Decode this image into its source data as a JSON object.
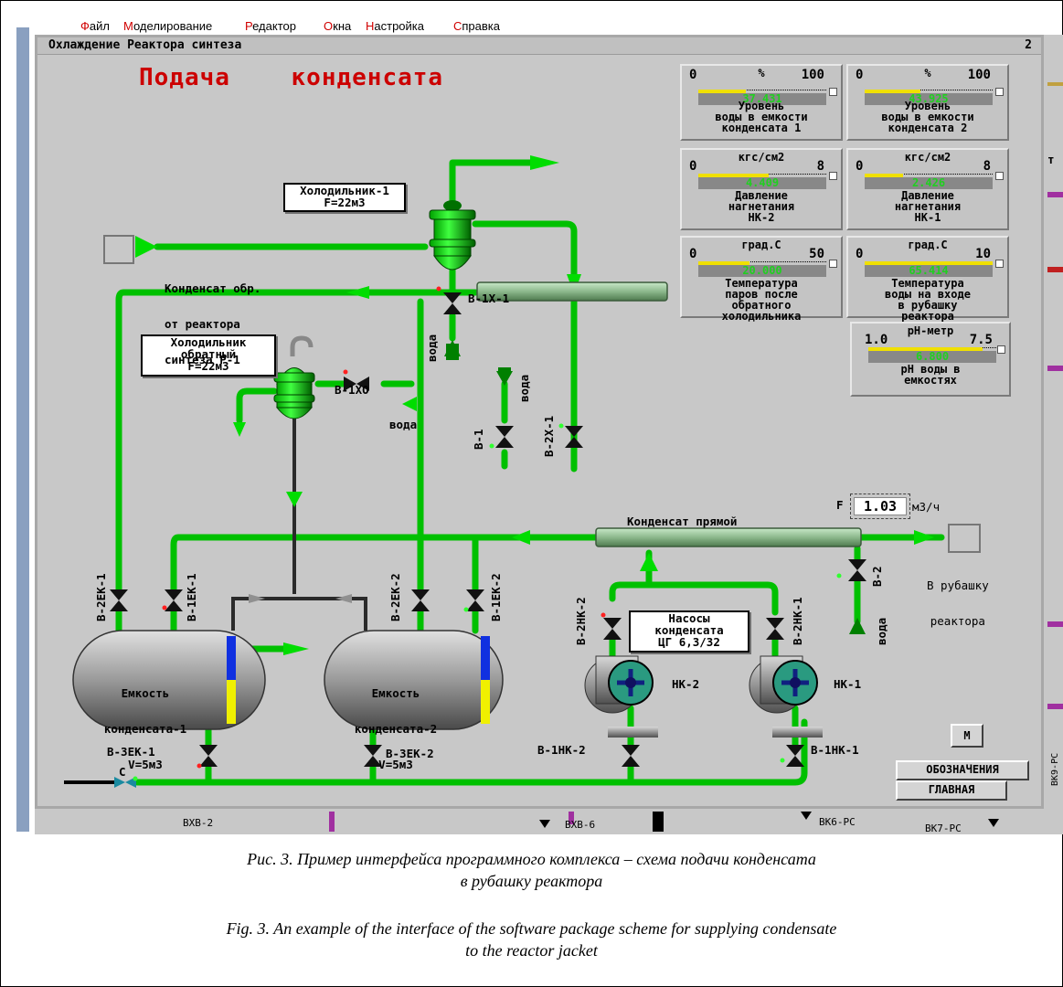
{
  "menu": [
    "Файл",
    "Моделирование",
    "Редактор",
    "Окна",
    "Настройка",
    "Справка"
  ],
  "window": {
    "title": "Охлаждение Реактора синтеза",
    "number": "2"
  },
  "heading": "Подача    конденсата",
  "equipment": {
    "cooler1": [
      "Холодильник-1",
      "F=22м3"
    ],
    "cooler_back": [
      "Холодильник",
      "обратный",
      "F=22м3"
    ],
    "tank1": [
      "Емкость",
      "конденсата-1",
      "V=5м3"
    ],
    "tank2": [
      "Емкость",
      "конденсата-2",
      "V=5м3"
    ],
    "pumps": [
      "Насосы",
      "конденсата",
      "ЦГ 6,3/32"
    ],
    "pump_nk1": "НК-1",
    "pump_nk2": "НК-2"
  },
  "labels": {
    "condensate_return": [
      "Конденсат обр.",
      "от реактора",
      "синтеза Р-1"
    ],
    "condensate_direct": "Конденсат прямой",
    "to_jacket": [
      "В рубашку",
      "реактора"
    ],
    "water": "вода",
    "flow_prefix": "F",
    "flow_value": "1.03",
    "flow_unit": "м3/ч"
  },
  "valves": {
    "v1x1": "В-1Х-1",
    "v1xo": "В-1ХО",
    "v1": "В-1",
    "v2x1": "В-2Х-1",
    "v2ek1": "В-2ЕК-1",
    "v1ek1": "В-1ЕК-1",
    "v2ek2": "В-2ЕК-2",
    "v1ek2": "В-1ЕК-2",
    "v2nk2": "В-2НК-2",
    "v2nk1": "В-2НК-1",
    "v2": "В-2",
    "v3ek1": "В-3ЕК-1",
    "v3ek2": "В-3ЕК-2",
    "v1nk2": "В-1НК-2",
    "v1nk1": "В-1НК-1",
    "c": "С"
  },
  "gauges": [
    {
      "unit": "%",
      "min": "0",
      "max": "100",
      "value": "37.431",
      "level": 0.374,
      "caption": "Уровень\nводы в емкости\nконденсата 1"
    },
    {
      "unit": "%",
      "min": "0",
      "max": "100",
      "value": "43.925",
      "level": 0.439,
      "caption": "Уровень\nводы в емкости\nконденсата 2"
    },
    {
      "unit": "кгс/см2",
      "min": "0",
      "max": "8",
      "value": "4.409",
      "level": 0.551,
      "caption": "Давление\nнагнетания\nНК-2"
    },
    {
      "unit": "кгс/см2",
      "min": "0",
      "max": "8",
      "value": "2.426",
      "level": 0.303,
      "caption": "Давление\nнагнетания\nНК-1"
    },
    {
      "unit": "град.С",
      "min": "0",
      "max": "50",
      "value": "20.000",
      "level": 0.4,
      "caption": "Температура\nпаров после\nобратного\nхолодильника"
    },
    {
      "unit": "град.С",
      "min": "0",
      "max": "10",
      "value": "65.414",
      "level": 1.0,
      "caption": "Температура\nводы на входе\nв рубашку\nреактора"
    },
    {
      "unit": "рН-метр",
      "min": "1.0",
      "max": "7.5",
      "value": "6.800",
      "level": 0.89,
      "caption": "рН воды в\nемкостях"
    }
  ],
  "buttons": {
    "m": "М",
    "legend": "ОБОЗНАЧЕНИЯ",
    "main": "ГЛАВНАЯ"
  },
  "bottom_labels": [
    "ВХВ-2",
    "ВХВ-6",
    "ВК6-РС",
    "ВК7-РС"
  ],
  "right_labels": [
    "т",
    "ВК9-РС"
  ],
  "captions": {
    "ru": [
      "Рис. 3. Пример интерфейса программного комплекса – схема подачи конденсата",
      "в рубашку реактора"
    ],
    "en": [
      "Fig. 3. An example of the interface of the software package scheme for supplying condensate",
      "to the reactor jacket"
    ]
  },
  "colors": {
    "pipe": "#00c000",
    "arrow": "#00dd00",
    "title": "#cc0000",
    "panel": "#c8c8c8"
  }
}
